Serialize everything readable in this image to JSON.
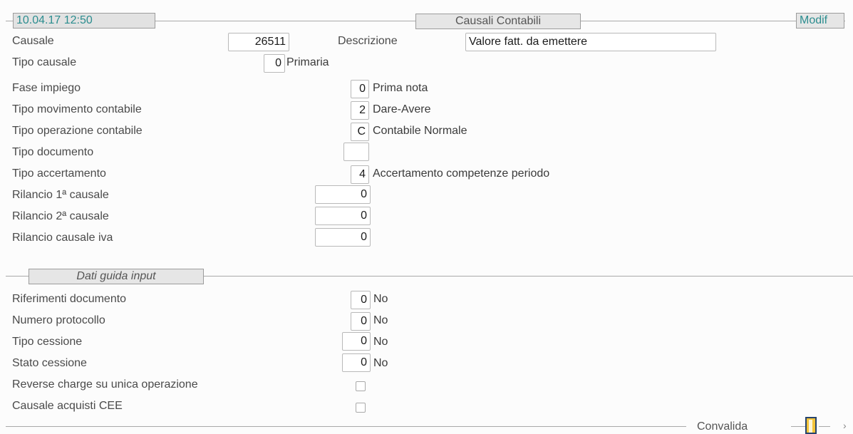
{
  "header": {
    "datetime": "10.04.17 12:50",
    "title": "Causali Contabili",
    "mode": "Modif"
  },
  "form": {
    "causale": {
      "label": "Causale",
      "value": "26511"
    },
    "descrizione": {
      "label": "Descrizione",
      "value": "Valore fatt. da emettere"
    },
    "tipo_causale": {
      "label": "Tipo causale",
      "value": "0",
      "desc": "Primaria"
    },
    "fase_impiego": {
      "label": "Fase impiego",
      "value": "0",
      "desc": "Prima nota"
    },
    "tipo_movimento": {
      "label": "Tipo movimento contabile",
      "value": "2",
      "desc": "Dare-Avere"
    },
    "tipo_operazione": {
      "label": "Tipo operazione contabile",
      "value": "C",
      "desc": "Contabile Normale"
    },
    "tipo_documento": {
      "label": "Tipo documento",
      "value": ""
    },
    "tipo_accertamento": {
      "label": "Tipo accertamento",
      "value": "4",
      "desc": "Accertamento competenze periodo"
    },
    "rilancio1": {
      "label": "Rilancio 1ª causale",
      "value": "0"
    },
    "rilancio2": {
      "label": "Rilancio 2ª causale",
      "value": "0"
    },
    "rilancio_iva": {
      "label": "Rilancio causale iva",
      "value": "0"
    }
  },
  "guida": {
    "section_title": "Dati guida input",
    "riferimenti": {
      "label": "Riferimenti documento",
      "value": "0",
      "desc": "No"
    },
    "protocollo": {
      "label": "Numero protocollo",
      "value": "0",
      "desc": "No"
    },
    "tipo_cessione": {
      "label": "Tipo cessione",
      "value": "0",
      "desc": "No"
    },
    "stato_cessione": {
      "label": "Stato cessione",
      "value": "0",
      "desc": "No"
    },
    "reverse_charge": {
      "label": "Reverse charge su unica operazione",
      "checked": false
    },
    "acquisti_cee": {
      "label": "Causale acquisti CEE",
      "checked": false
    }
  },
  "footer": {
    "convalida": "Convalida"
  }
}
